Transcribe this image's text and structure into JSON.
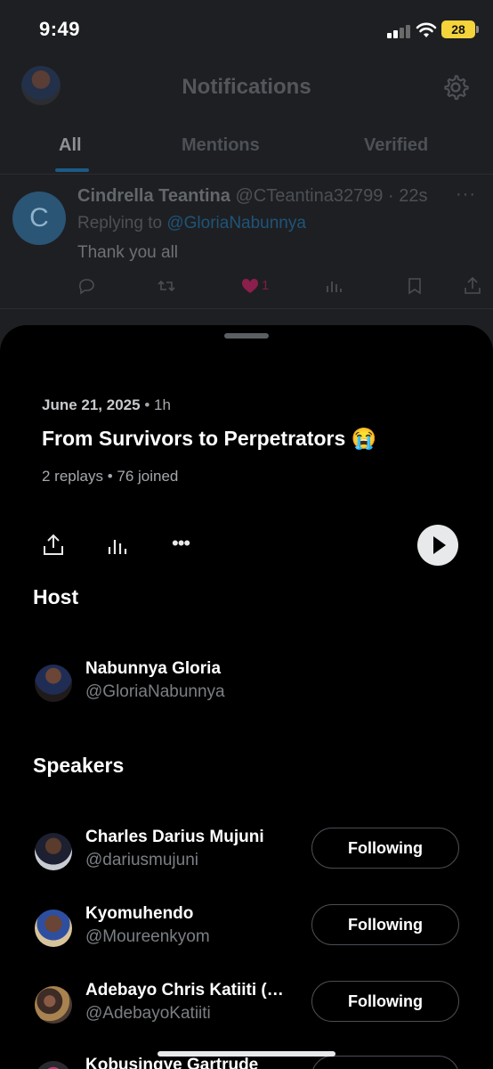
{
  "status_bar": {
    "time": "9:49",
    "battery": "28"
  },
  "header": {
    "title": "Notifications"
  },
  "tabs": [
    {
      "label": "All",
      "active": true
    },
    {
      "label": "Mentions",
      "active": false
    },
    {
      "label": "Verified",
      "active": false
    }
  ],
  "tweet": {
    "avatar_letter": "C",
    "name": "Cindrella Teantina",
    "handle": "@CTeantina32799",
    "time": "· 22s",
    "more": "···",
    "replying_prefix": "Replying to ",
    "replying_to": "@GloriaNabunnya",
    "text": "Thank you all",
    "like_count": "1"
  },
  "space": {
    "date": "June 21, 2025",
    "ago": "• 1h",
    "title": "From Survivors to Perpetrators 😭",
    "stats": "2 replays • 76 joined",
    "more": "•••"
  },
  "host": {
    "section_label": "Host",
    "name": "Nabunnya Gloria",
    "handle": "@GloriaNabunnya"
  },
  "speakers": {
    "section_label": "Speakers",
    "items": [
      {
        "name": "Charles Darius Mujuni",
        "handle": "@dariusmujuni",
        "button": "Following"
      },
      {
        "name": "Kyomuhendo",
        "handle": "@Moureenkyom",
        "button": "Following"
      },
      {
        "name": "Adebayo Chris Katiiti (…",
        "handle": "@AdebayoKatiiti",
        "button": "Following"
      },
      {
        "name": "Kobusingye Gartrude",
        "handle": "",
        "button": ""
      }
    ]
  },
  "colors": {
    "accent": "#1d9bf0",
    "like": "#f91880",
    "sheet_bg": "#000000"
  }
}
